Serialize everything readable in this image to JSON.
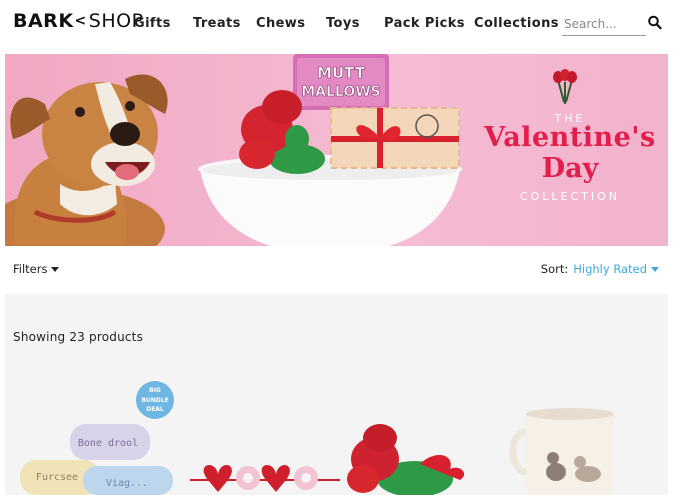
{
  "header": {
    "logo_bark": "BARK",
    "logo_shop": "SHOP",
    "nav": [
      {
        "label": "Gifts"
      },
      {
        "label": "Treats"
      },
      {
        "label": "Chews"
      },
      {
        "label": "Toys"
      },
      {
        "label": "Pack Picks"
      },
      {
        "label": "Collections"
      }
    ],
    "search": {
      "placeholder": "Search...",
      "value": ""
    },
    "icons": {
      "search": "search-icon"
    }
  },
  "hero": {
    "the": "THE",
    "title_line1": "Valentine's",
    "title_line2": "Day",
    "collection": "COLLECTION",
    "treat_pack_line1": "MUTT",
    "treat_pack_line2": "MALLOWS",
    "colors": {
      "background": "#f3b4cd",
      "title": "#e21f4c"
    }
  },
  "filterbar": {
    "filters_label": "Filters",
    "sort_label": "Sort:",
    "sort_value": "Highly Rated",
    "sort_color": "#3fa9dd"
  },
  "products": {
    "showing_text": "Showing 23 products",
    "badge_text_1": "BIG",
    "badge_text_2": "BUNDLE",
    "badge_text_3": "DEAL",
    "pillow_text_1": "Bone drool",
    "pillow_text_2": "Furcsee",
    "pillow_text_3": "Viag..."
  }
}
